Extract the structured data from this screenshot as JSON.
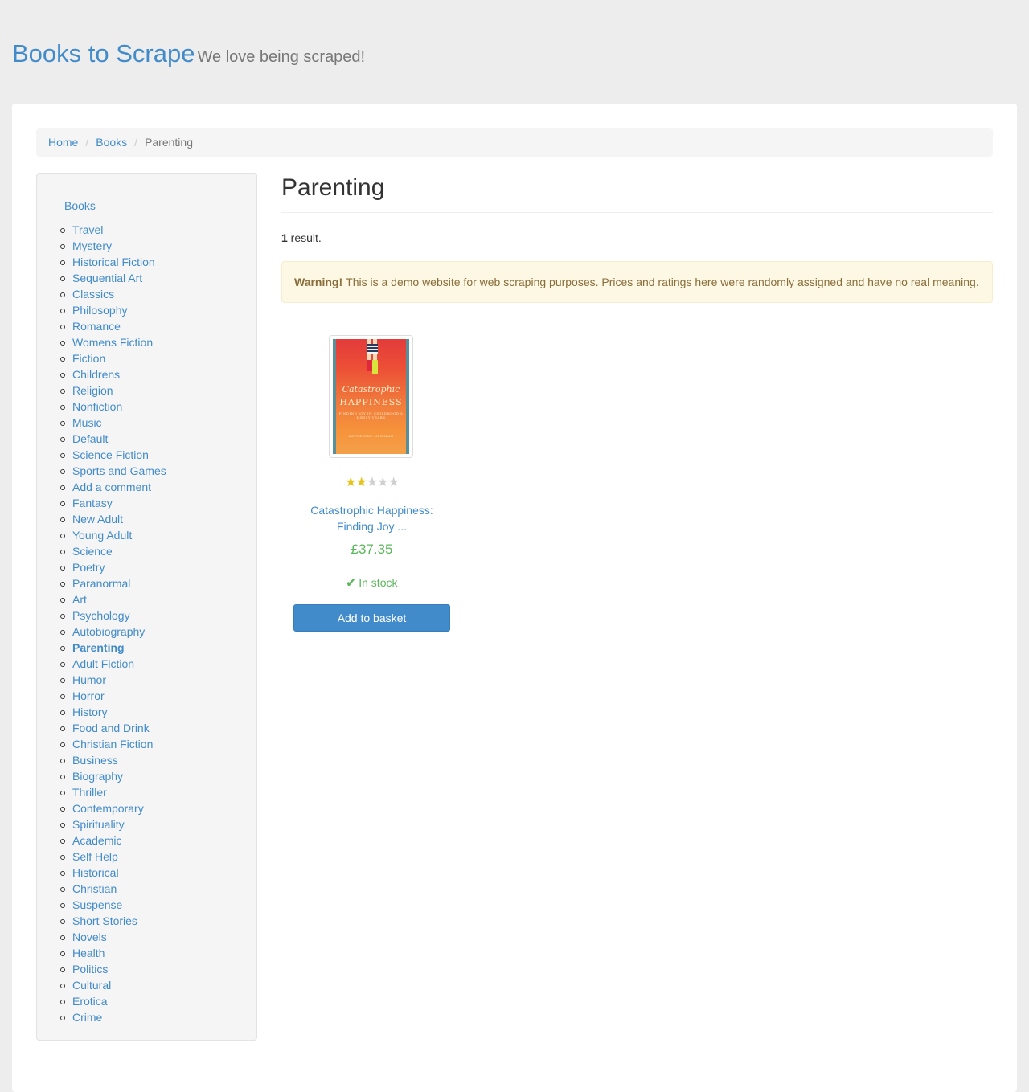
{
  "header": {
    "brand": "Books to Scrape",
    "tagline": "We love being scraped!"
  },
  "breadcrumb": {
    "home": "Home",
    "books": "Books",
    "current": "Parenting",
    "separator": "/"
  },
  "sidebar": {
    "top_link": "Books",
    "active_category": "Parenting",
    "categories": [
      "Travel",
      "Mystery",
      "Historical Fiction",
      "Sequential Art",
      "Classics",
      "Philosophy",
      "Romance",
      "Womens Fiction",
      "Fiction",
      "Childrens",
      "Religion",
      "Nonfiction",
      "Music",
      "Default",
      "Science Fiction",
      "Sports and Games",
      "Add a comment",
      "Fantasy",
      "New Adult",
      "Young Adult",
      "Science",
      "Poetry",
      "Paranormal",
      "Art",
      "Psychology",
      "Autobiography",
      "Parenting",
      "Adult Fiction",
      "Humor",
      "Horror",
      "History",
      "Food and Drink",
      "Christian Fiction",
      "Business",
      "Biography",
      "Thriller",
      "Contemporary",
      "Spirituality",
      "Academic",
      "Self Help",
      "Historical",
      "Christian",
      "Suspense",
      "Short Stories",
      "Novels",
      "Health",
      "Politics",
      "Cultural",
      "Erotica",
      "Crime"
    ]
  },
  "main": {
    "title": "Parenting",
    "result_count": "1",
    "result_suffix": " result.",
    "alert_strong": "Warning!",
    "alert_text": "This is a demo website for web scraping purposes. Prices and ratings here were randomly assigned and have no real meaning."
  },
  "product": {
    "title_line1": "Catastrophic Happiness:",
    "title_line2": "Finding Joy ...",
    "rating": 2,
    "rating_max": 5,
    "price": "£37.35",
    "availability": "In stock",
    "add_button": "Add to basket",
    "cover": {
      "title_script": "Catastrophic",
      "title_main": "HAPPINESS",
      "subtitle": "FINDING JOY IN CHILDHOOD'S MESSY YEARS",
      "author": "CATHERINE NEWMAN"
    }
  },
  "colors": {
    "link": "#428bca",
    "price": "#5cb85c",
    "star_on": "#e7c418",
    "star_off": "#d0d0d0",
    "alert_bg": "#fcf8e3",
    "button": "#428bca"
  }
}
